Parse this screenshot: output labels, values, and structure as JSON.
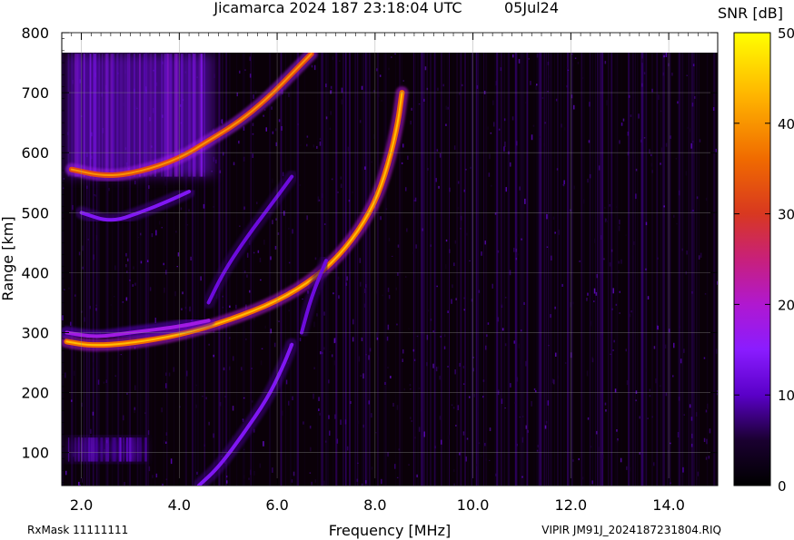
{
  "header": {
    "title": "Jicamarca 2024 187 23:18:04 UTC",
    "date": "05Jul24"
  },
  "footer": {
    "rxmask": "RxMask 11111111",
    "file": "VIPIR  JM91J_2024187231804.RIQ"
  },
  "colorbar": {
    "label": "SNR [dB]",
    "ticks": [
      0,
      10,
      20,
      30,
      40,
      50
    ],
    "range": [
      0,
      50
    ]
  },
  "chart_data": {
    "type": "heatmap",
    "title": "Jicamarca 2024 187 23:18:04 UTC",
    "xlabel": "Frequency [MHz]",
    "ylabel": "Range [km]",
    "xlim": [
      1.6,
      15.0
    ],
    "ylim": [
      45,
      800
    ],
    "x_ticks": [
      "2.0",
      "4.0",
      "6.0",
      "8.0",
      "10.0",
      "12.0",
      "14.0"
    ],
    "y_ticks": [
      "100",
      "200",
      "300",
      "400",
      "500",
      "600",
      "700",
      "800"
    ],
    "grid": true,
    "colorscale": "SNR [dB], 0 to 50",
    "traces": [
      {
        "name": "",
        "points": [
          [
            1.7,
            285
          ],
          [
            2.2,
            278
          ],
          [
            3.0,
            282
          ],
          [
            4.0,
            296
          ],
          [
            5.0,
            320
          ],
          [
            6.0,
            352
          ],
          [
            6.8,
            392
          ],
          [
            7.4,
            440
          ],
          [
            7.9,
            500
          ],
          [
            8.2,
            560
          ],
          [
            8.45,
            640
          ],
          [
            8.55,
            700
          ]
        ],
        "snr": 36
      },
      {
        "name": "",
        "points": [
          [
            1.7,
            300
          ],
          [
            2.3,
            292
          ],
          [
            3.0,
            300
          ],
          [
            4.0,
            310
          ],
          [
            4.6,
            320
          ]
        ],
        "snr": 18
      },
      {
        "name": "",
        "points": [
          [
            1.8,
            572
          ],
          [
            2.5,
            560
          ],
          [
            3.2,
            568
          ],
          [
            4.0,
            590
          ],
          [
            4.6,
            620
          ],
          [
            5.2,
            650
          ],
          [
            5.8,
            690
          ],
          [
            6.4,
            740
          ],
          [
            6.7,
            765
          ]
        ],
        "snr": 32
      },
      {
        "name": "",
        "points": [
          [
            2.0,
            500
          ],
          [
            2.6,
            484
          ],
          [
            3.2,
            500
          ],
          [
            3.8,
            520
          ],
          [
            4.2,
            535
          ]
        ],
        "snr": 14
      },
      {
        "name": "",
        "points": [
          [
            4.4,
            45
          ],
          [
            4.8,
            75
          ],
          [
            5.3,
            130
          ],
          [
            5.8,
            190
          ],
          [
            6.1,
            240
          ],
          [
            6.3,
            280
          ]
        ],
        "snr": 14
      },
      {
        "name": "",
        "points": [
          [
            4.6,
            350
          ],
          [
            4.9,
            400
          ],
          [
            5.3,
            450
          ],
          [
            5.8,
            505
          ],
          [
            6.3,
            560
          ]
        ],
        "snr": 12
      },
      {
        "name": "",
        "points": [
          [
            6.5,
            300
          ],
          [
            6.7,
            360
          ],
          [
            7.0,
            420
          ]
        ],
        "snr": 12
      }
    ],
    "diffuse_regions": [
      {
        "x": [
          1.7,
          4.7
        ],
        "y": [
          560,
          765
        ],
        "snr": 12
      },
      {
        "x": [
          1.7,
          3.3
        ],
        "y": [
          85,
          125
        ],
        "snr": 8
      }
    ]
  }
}
